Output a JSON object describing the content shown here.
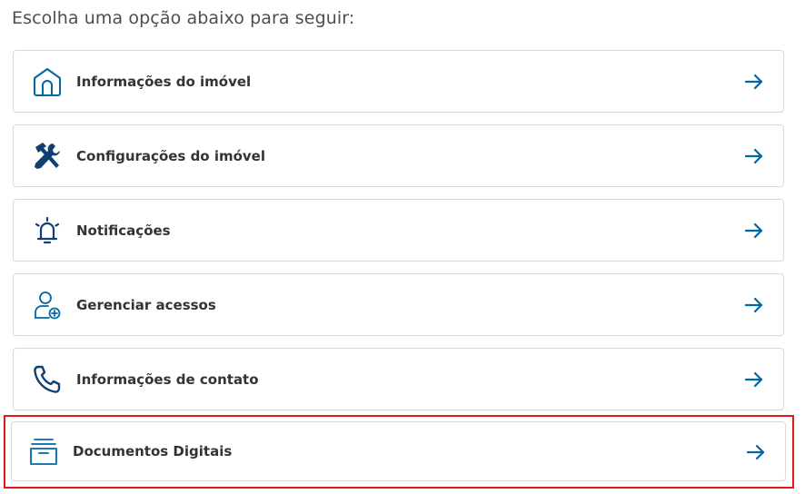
{
  "page": {
    "heading": "Escolha uma opção abaixo para seguir:"
  },
  "colors": {
    "accent": "#0067a5",
    "highlight": "#e0191b",
    "card_border": "#d9d9d9",
    "label": "#333333"
  },
  "options": [
    {
      "label": "Informações do imóvel",
      "icon": "house-icon"
    },
    {
      "label": "Configurações do imóvel",
      "icon": "tools-icon"
    },
    {
      "label": "Notificações",
      "icon": "alarm-bell-icon"
    },
    {
      "label": "Gerenciar acessos",
      "icon": "user-add-icon"
    },
    {
      "label": "Informações de contato",
      "icon": "phone-icon"
    },
    {
      "label": "Documentos Digitais",
      "icon": "archive-box-icon",
      "highlighted": true
    }
  ]
}
